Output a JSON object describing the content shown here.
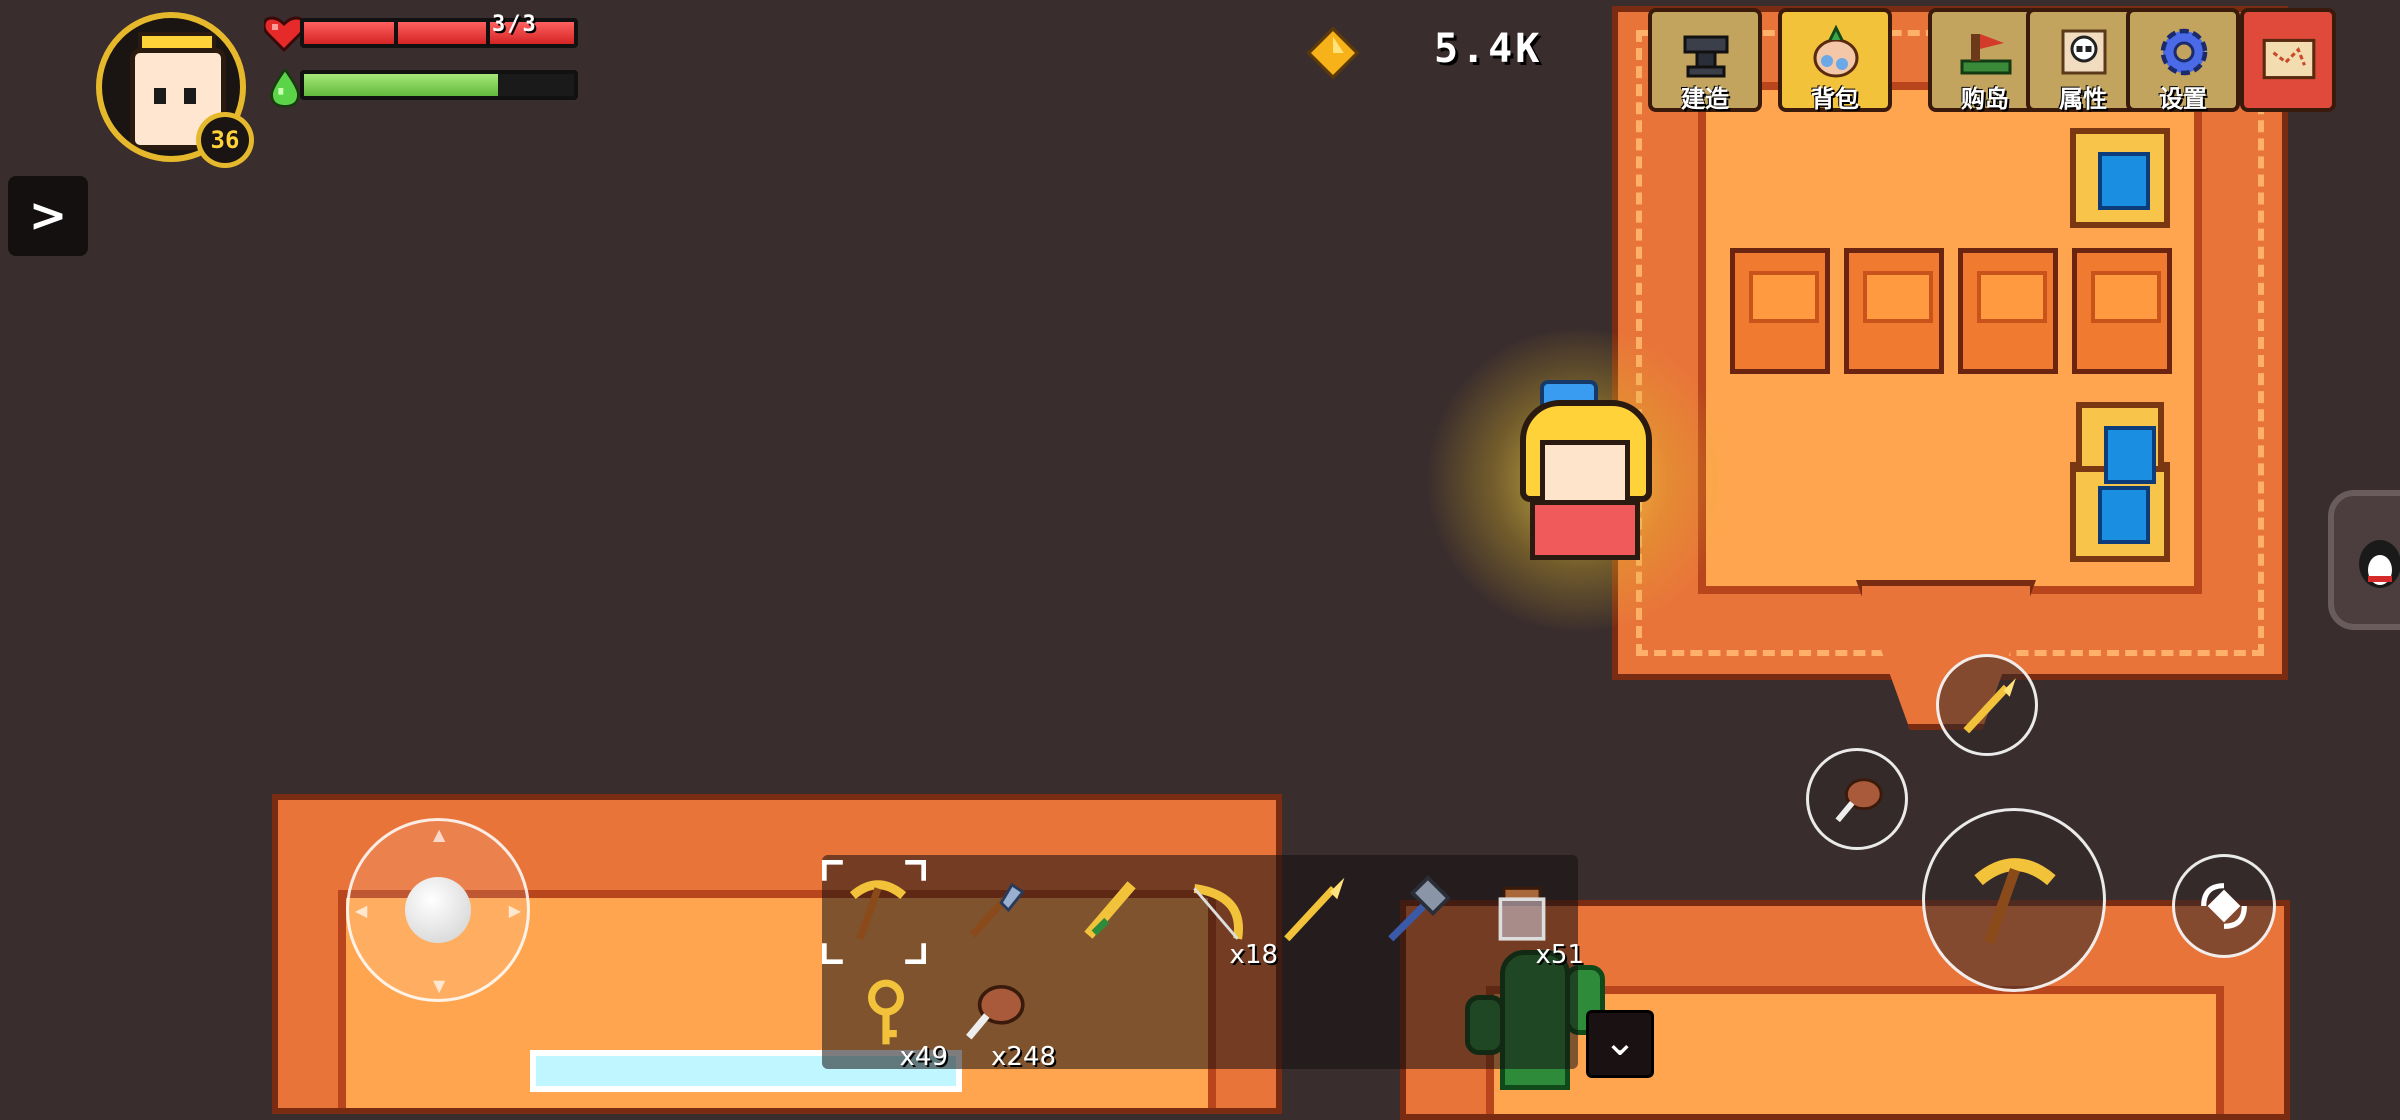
{
  "player": {
    "level": "36",
    "hp_text": "3/3",
    "hp_fraction": 1.0,
    "energy_fraction": 0.72
  },
  "currency": {
    "gem_count": "5.4K",
    "icon": "gem-icon"
  },
  "top_menu": {
    "items": [
      {
        "label": "建造",
        "icon": "anvil-icon"
      },
      {
        "label": "背包",
        "icon": "backpack-icon"
      },
      {
        "label": "购岛",
        "icon": "island-icon"
      },
      {
        "label": "属性",
        "icon": "scroll-skull-icon"
      },
      {
        "label": "设置",
        "icon": "gear-icon"
      }
    ],
    "map_icon": "map-scroll-icon"
  },
  "side_toggle_glyph": ">",
  "hotbar": {
    "slots": [
      {
        "icon": "pickaxe-icon",
        "count": "",
        "selected": true
      },
      {
        "icon": "shovel-icon",
        "count": ""
      },
      {
        "icon": "golden-sword-icon",
        "count": ""
      },
      {
        "icon": "bow-icon",
        "count": "x18"
      },
      {
        "icon": "spear-icon",
        "count": ""
      },
      {
        "icon": "hammer-icon",
        "count": ""
      },
      {
        "icon": "jar-icon",
        "count": "x51"
      },
      {
        "icon": "key-icon",
        "count": "x49"
      },
      {
        "icon": "meat-icon",
        "count": "x248"
      }
    ],
    "expand_glyph": "⌄"
  },
  "actions": {
    "weapon_icon": "golden-spear-icon",
    "food_icon": "meat-icon",
    "attack_icon": "pickaxe-icon",
    "dodge_icon": "dodge-roll-icon"
  },
  "colors": {
    "background": "#3a2d2d",
    "terrain_orange": "#e9743a",
    "floor_sand": "#ffa550",
    "hp_red": "#d42424",
    "energy_green": "#62b83a",
    "gold": "#f2c23a"
  }
}
